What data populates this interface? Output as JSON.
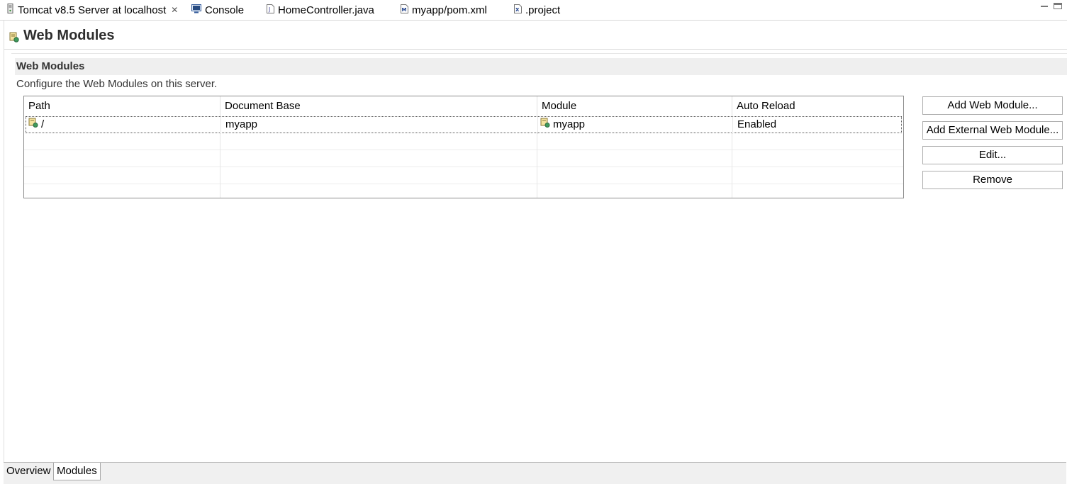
{
  "tabs": [
    {
      "label": "Tomcat v8.5 Server at localhost",
      "icon": "server-icon",
      "active": true,
      "close": "✕"
    },
    {
      "label": "Console",
      "icon": "console-icon"
    },
    {
      "label": "HomeController.java",
      "icon": "java-file-icon"
    },
    {
      "label": "myapp/pom.xml",
      "icon": "maven-pom-icon"
    },
    {
      "label": ".project",
      "icon": "xml-file-icon"
    }
  ],
  "page": {
    "title": "Web Modules"
  },
  "section": {
    "title": "Web Modules",
    "description": "Configure the Web Modules on this server."
  },
  "table": {
    "columns": [
      "Path",
      "Document Base",
      "Module",
      "Auto Reload"
    ],
    "rows": [
      {
        "path": "/",
        "document_base": "myapp",
        "module": "myapp",
        "auto_reload": "Enabled"
      }
    ]
  },
  "buttons": {
    "add_web_module": "Add Web Module...",
    "add_external": "Add External Web Module...",
    "edit": "Edit...",
    "remove": "Remove"
  },
  "form_tabs": [
    {
      "label": "Overview"
    },
    {
      "label": "Modules",
      "active": true
    }
  ]
}
